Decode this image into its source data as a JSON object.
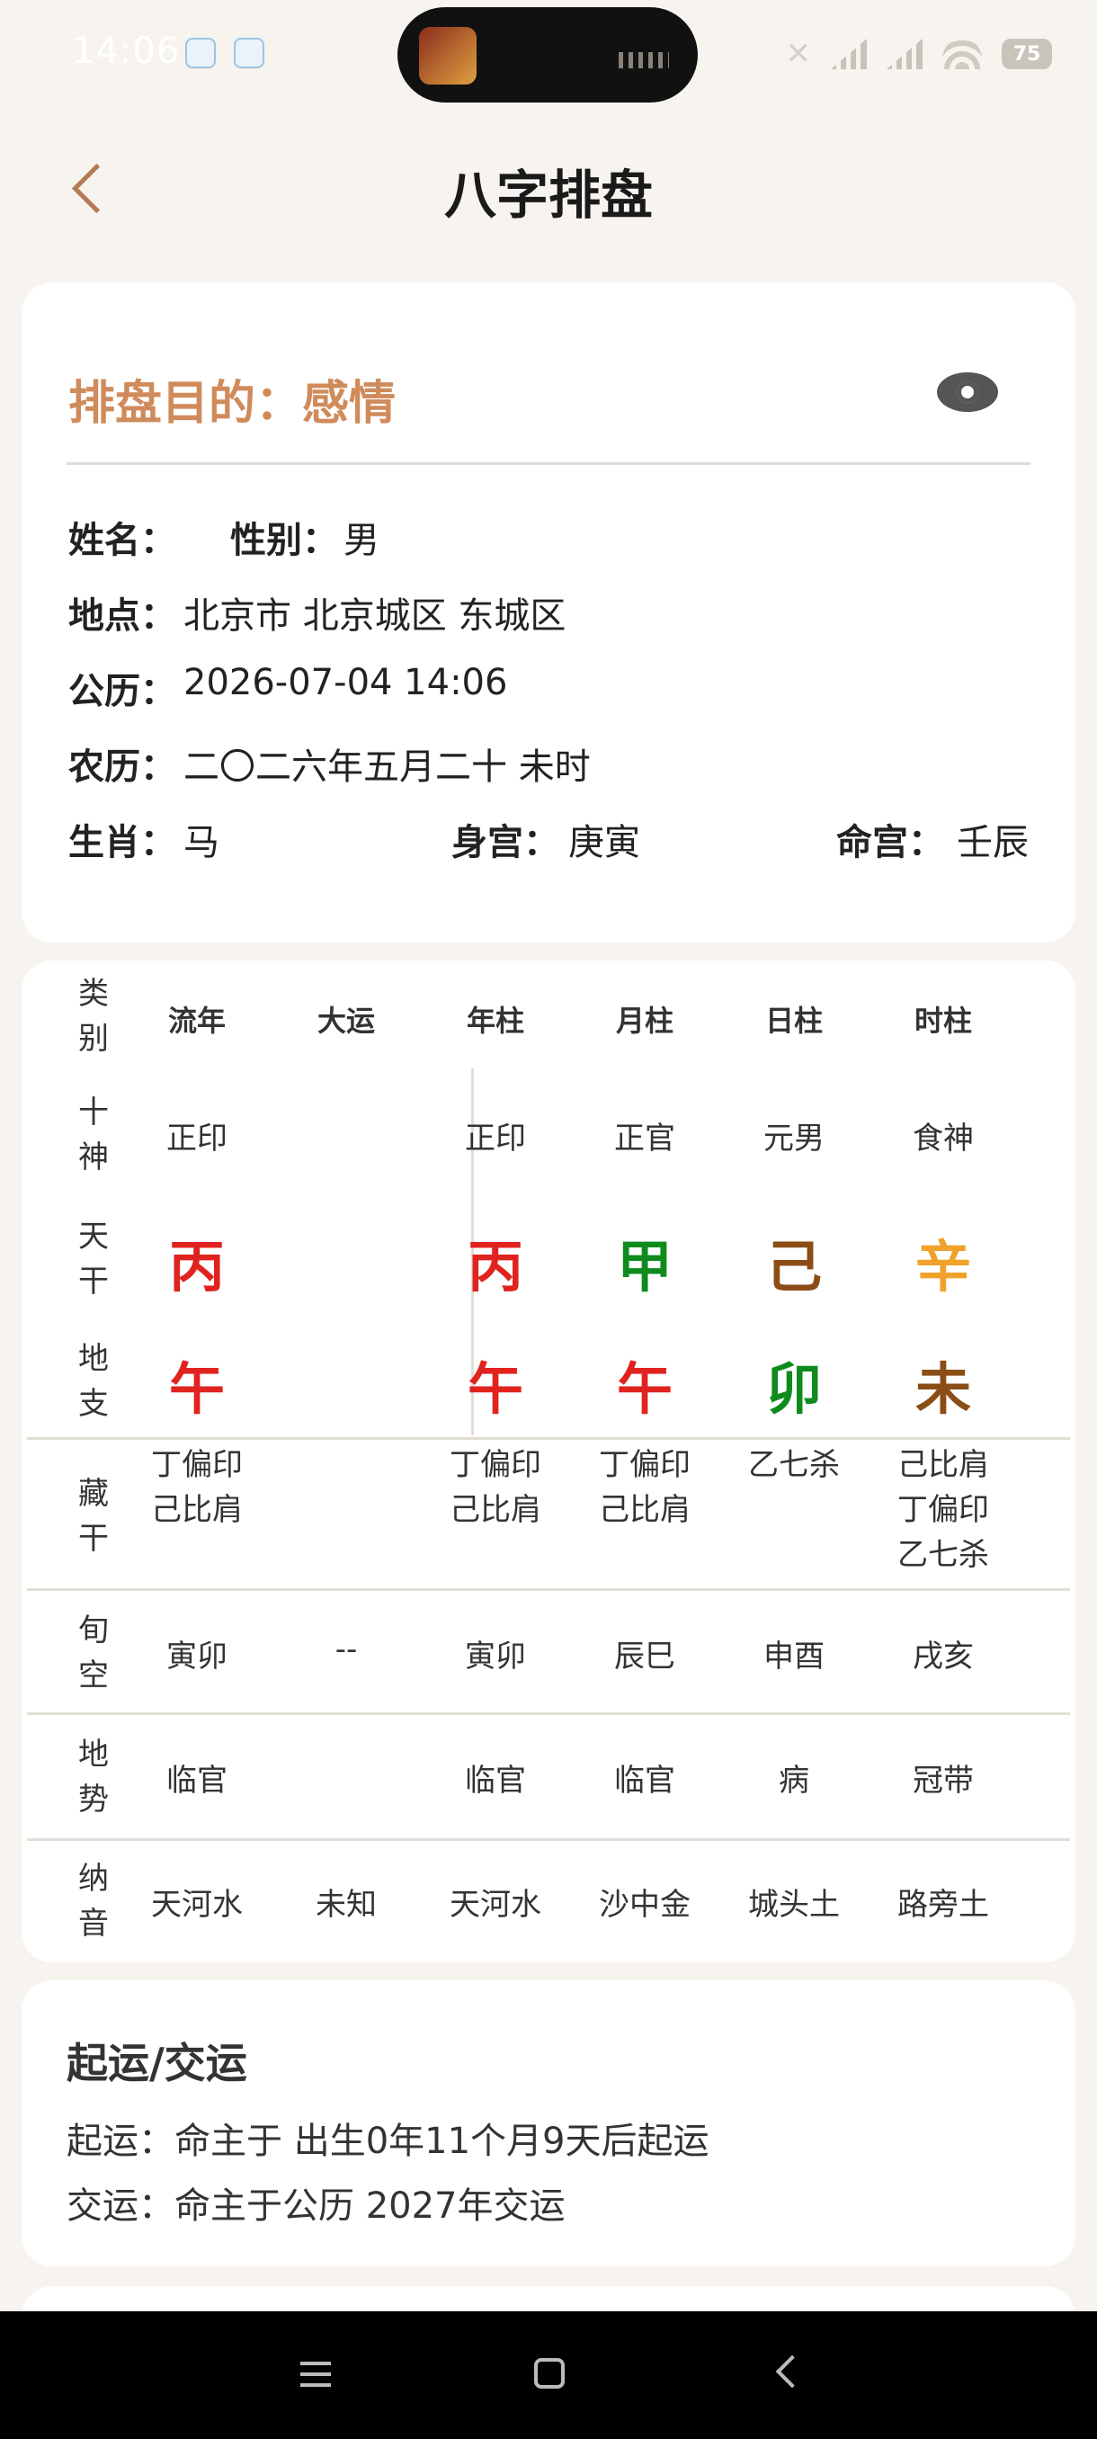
{
  "status_bar": {
    "time": "14:06",
    "battery": "75",
    "icons": [
      "cloud-icon",
      "cloud-icon",
      "mute-icon",
      "signal-icon",
      "wifi-icon",
      "battery-icon"
    ]
  },
  "header": {
    "title": "八字排盘",
    "back_icon": "chevron-left-icon"
  },
  "info": {
    "purpose": "排盘目的：感情",
    "eye_icon": "eye-icon",
    "name_label": "姓名：",
    "name_value": "",
    "gender_label": "性别：",
    "gender_value": "男",
    "place_label": "地点：",
    "place_value": "北京市 北京城区 东城区",
    "solar_label": "公历：",
    "solar_value": "2026-07-04 14:06",
    "lunar_label": "农历：",
    "lunar_value": "二〇二六年五月二十 未时",
    "zodiac_label": "生肖：",
    "zodiac_value": "马",
    "body_palace_label": "身宫：",
    "body_palace_value": "庚寅",
    "life_palace_label": "命宫：",
    "life_palace_value": "壬辰"
  },
  "chart": {
    "headers": [
      "流年",
      "大运",
      "年柱",
      "月柱",
      "日柱",
      "时柱"
    ],
    "category_label": [
      "类",
      "别"
    ],
    "rows": {
      "shishen": {
        "label": [
          "十",
          "神"
        ],
        "values": [
          "正印",
          "",
          "正印",
          "正官",
          "元男",
          "食神"
        ]
      },
      "tiangan": {
        "label": [
          "天",
          "干"
        ],
        "values": [
          "丙",
          "",
          "丙",
          "甲",
          "己",
          "辛"
        ],
        "colors": [
          "#e0231f",
          "",
          "#e0231f",
          "#0f8a1c",
          "#8b4d16",
          "#f0a22a"
        ]
      },
      "dizhi": {
        "label": [
          "地",
          "支"
        ],
        "values": [
          "午",
          "",
          "午",
          "午",
          "卯",
          "未"
        ],
        "colors": [
          "#e0231f",
          "",
          "#e0231f",
          "#e0231f",
          "#0f8a1c",
          "#8b4d16"
        ]
      },
      "canggan": {
        "label": [
          "藏",
          "干"
        ],
        "values": [
          [
            "丁偏印",
            "己比肩"
          ],
          [],
          [
            "丁偏印",
            "己比肩"
          ],
          [
            "丁偏印",
            "己比肩"
          ],
          [
            "乙七杀"
          ],
          [
            "己比肩",
            "丁偏印",
            "乙七杀"
          ]
        ]
      },
      "xunkong": {
        "label": [
          "旬",
          "空"
        ],
        "values": [
          "寅卯",
          "--",
          "寅卯",
          "辰巳",
          "申酉",
          "戌亥"
        ]
      },
      "dishi": {
        "label": [
          "地",
          "势"
        ],
        "values": [
          "临官",
          "",
          "临官",
          "临官",
          "病",
          "冠带"
        ]
      },
      "nayin": {
        "label": [
          "纳",
          "音"
        ],
        "values": [
          "天河水",
          "未知",
          "天河水",
          "沙中金",
          "城头土",
          "路旁土"
        ]
      }
    }
  },
  "luck": {
    "title": "起运/交运",
    "start": "起运：命主于 出生0年11个月9天后起运",
    "transfer": "交运：命主于公历 2027年交运"
  },
  "nav": {
    "icons": [
      "menu-icon",
      "home-icon",
      "back-icon"
    ]
  }
}
